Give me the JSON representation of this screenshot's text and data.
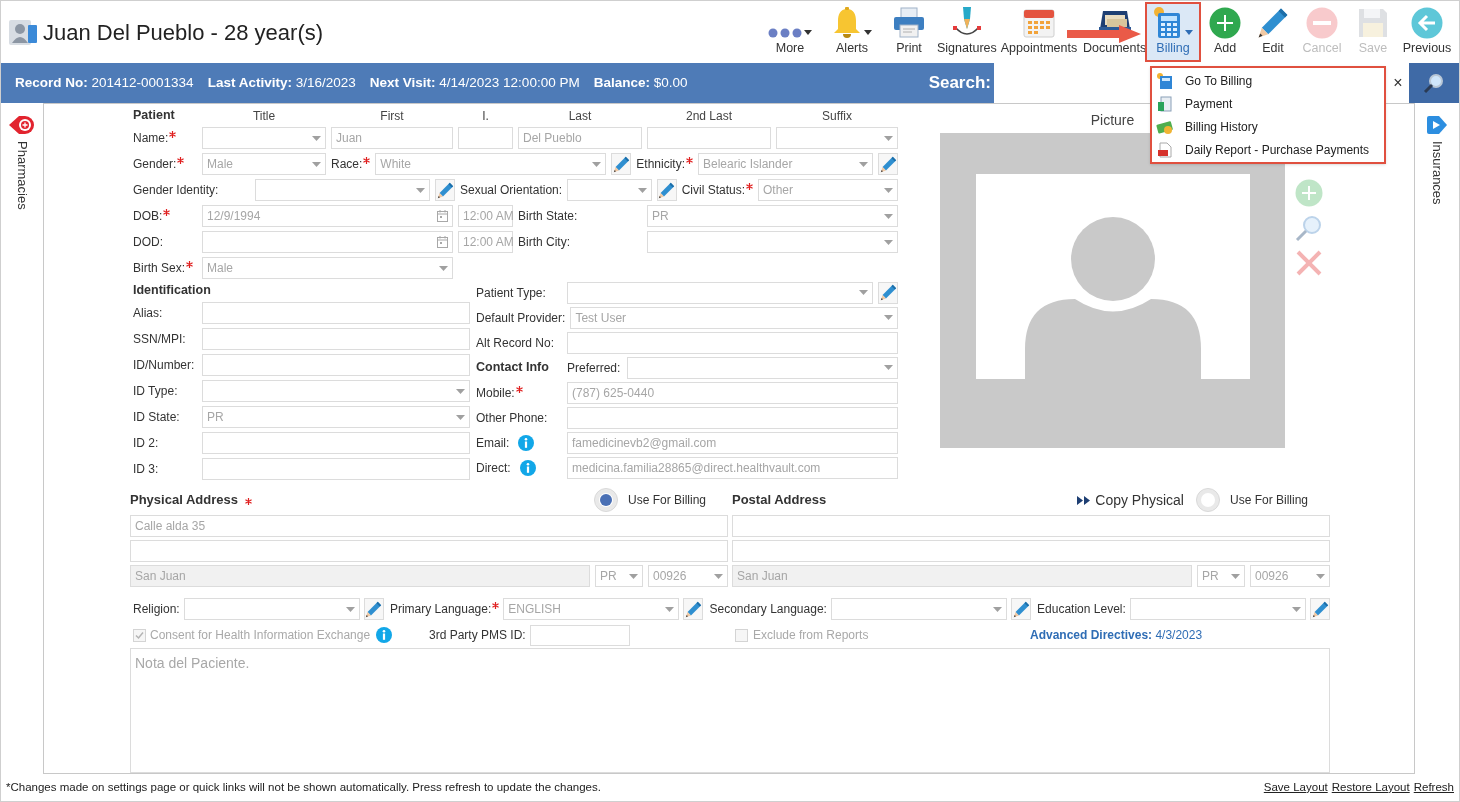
{
  "header": {
    "title": "Juan Del Pueblo - 28 year(s)"
  },
  "toolbar": [
    {
      "label": "More",
      "dropdown": true,
      "disabled": false,
      "selected": false
    },
    {
      "label": "Alerts",
      "dropdown": true,
      "disabled": false,
      "selected": false
    },
    {
      "label": "Print",
      "dropdown": false,
      "disabled": false,
      "selected": false
    },
    {
      "label": "Signatures",
      "dropdown": false,
      "disabled": false,
      "selected": false
    },
    {
      "label": "Appointments",
      "dropdown": false,
      "disabled": false,
      "selected": false
    },
    {
      "label": "Documents",
      "dropdown": false,
      "disabled": false,
      "selected": false
    },
    {
      "label": "Billing",
      "dropdown": true,
      "disabled": false,
      "selected": true
    },
    {
      "label": "Add",
      "dropdown": false,
      "disabled": false,
      "selected": false
    },
    {
      "label": "Edit",
      "dropdown": false,
      "disabled": false,
      "selected": false
    },
    {
      "label": "Cancel",
      "dropdown": false,
      "disabled": true,
      "selected": false
    },
    {
      "label": "Save",
      "dropdown": false,
      "disabled": true,
      "selected": false
    },
    {
      "label": "Previous",
      "dropdown": false,
      "disabled": false,
      "selected": false
    }
  ],
  "billing_menu": [
    "Go To Billing",
    "Payment",
    "Billing History",
    "Daily Report - Purchase Payments"
  ],
  "info_bar": [
    {
      "label": "Record No:",
      "value": "201412-0001334"
    },
    {
      "label": "Last Activity:",
      "value": "3/16/2023"
    },
    {
      "label": "Next Visit:",
      "value": "4/14/2023 12:00:00 PM"
    },
    {
      "label": "Balance:",
      "value": "$0.00"
    }
  ],
  "search": {
    "label": "Search:",
    "clear": "×"
  },
  "side_tabs": {
    "left": "Pharmacies",
    "right": "Insurances"
  },
  "patient_rows": [
    [
      {
        "kind": "heading",
        "text": "Patient"
      },
      {
        "kind": "column",
        "text": "Title"
      },
      {
        "kind": "column",
        "text": "First"
      },
      {
        "kind": "column",
        "text": "I."
      },
      {
        "kind": "column",
        "text": "Last"
      },
      {
        "kind": "column",
        "text": "2nd Last"
      },
      {
        "kind": "column",
        "text": "Suffix"
      }
    ],
    [
      {
        "kind": "label",
        "text": "Name:",
        "required": true
      },
      {
        "kind": "select"
      },
      {
        "kind": "text",
        "value": "Juan"
      },
      {
        "kind": "text"
      },
      {
        "kind": "text",
        "value": "Del Pueblo"
      },
      {
        "kind": "text"
      },
      {
        "kind": "select"
      }
    ],
    [
      {
        "kind": "label",
        "text": "Gender:",
        "required": true
      },
      {
        "kind": "select",
        "value": "Male"
      },
      {
        "kind": "label",
        "text": "Race:",
        "required": true
      },
      {
        "kind": "select",
        "value": "White"
      },
      {
        "kind": "edit"
      },
      {
        "kind": "label",
        "text": "Ethnicity:",
        "required": true
      },
      {
        "kind": "select",
        "value": "Belearic Islander"
      },
      {
        "kind": "edit"
      }
    ],
    [
      {
        "kind": "label",
        "text": "Gender Identity:",
        "required": false
      },
      {
        "kind": "select"
      },
      {
        "kind": "edit"
      },
      {
        "kind": "label",
        "text": "Sexual Orientation:",
        "required": false
      },
      {
        "kind": "select"
      },
      {
        "kind": "edit"
      },
      {
        "kind": "label",
        "text": "Civil Status:",
        "required": true
      },
      {
        "kind": "select",
        "value": "Other"
      }
    ],
    [
      {
        "kind": "label",
        "text": "DOB:",
        "required": true
      },
      {
        "kind": "date",
        "value": "12/9/1994"
      },
      {
        "kind": "time",
        "value": "12:00 AM"
      },
      {
        "kind": "label",
        "text": "Birth State:",
        "required": false
      },
      {
        "kind": "select",
        "value": "PR"
      }
    ],
    [
      {
        "kind": "label",
        "text": "DOD:",
        "required": false
      },
      {
        "kind": "date"
      },
      {
        "kind": "time",
        "value": "12:00 AM"
      },
      {
        "kind": "label",
        "text": "Birth City:",
        "required": false
      },
      {
        "kind": "select"
      }
    ],
    [
      {
        "kind": "label",
        "text": "Birth Sex:",
        "required": true
      },
      {
        "kind": "select",
        "value": "Male"
      }
    ]
  ],
  "identification": {
    "heading": "Identification",
    "rows": [
      [
        {
          "kind": "label",
          "text": "Alias:",
          "required": false
        },
        {
          "kind": "text"
        }
      ],
      [
        {
          "kind": "label",
          "text": "SSN/MPI:",
          "required": false
        },
        {
          "kind": "text"
        }
      ],
      [
        {
          "kind": "label",
          "text": "ID/Number:",
          "required": false
        },
        {
          "kind": "text"
        }
      ],
      [
        {
          "kind": "label",
          "text": "ID Type:",
          "required": false
        },
        {
          "kind": "select"
        }
      ],
      [
        {
          "kind": "label",
          "text": "ID State:",
          "required": false
        },
        {
          "kind": "select",
          "value": "PR"
        }
      ],
      [
        {
          "kind": "label",
          "text": "ID 2:",
          "required": false
        },
        {
          "kind": "text"
        }
      ],
      [
        {
          "kind": "label",
          "text": "ID 3:",
          "required": false
        },
        {
          "kind": "text"
        }
      ]
    ]
  },
  "contact_rows": [
    [
      {
        "kind": "label",
        "text": "Patient Type:",
        "required": false
      },
      {
        "kind": "select"
      },
      {
        "kind": "edit"
      }
    ],
    [
      {
        "kind": "label",
        "text": "Default Provider:",
        "required": false
      },
      {
        "kind": "select",
        "value": "Test User"
      }
    ],
    [
      {
        "kind": "label",
        "text": "Alt Record No:",
        "required": false
      },
      {
        "kind": "text"
      }
    ],
    [
      {
        "kind": "heading",
        "text": "Contact Info"
      },
      {
        "kind": "label",
        "text": "Preferred:",
        "required": false
      },
      {
        "kind": "select"
      }
    ],
    [
      {
        "kind": "label",
        "text": "Mobile:",
        "required": true
      },
      {
        "kind": "text",
        "value": "(787) 625-0440"
      }
    ],
    [
      {
        "kind": "label",
        "text": "Other Phone:",
        "required": false
      },
      {
        "kind": "text"
      }
    ],
    [
      {
        "kind": "label",
        "text": "Email:",
        "required": false
      },
      {
        "kind": "info"
      },
      {
        "kind": "text",
        "value": "famedicinevb2@gmail.com"
      }
    ],
    [
      {
        "kind": "label",
        "text": "Direct:",
        "required": false
      },
      {
        "kind": "info"
      },
      {
        "kind": "text",
        "value": "medicina.familia28865@direct.healthvault.com"
      }
    ]
  ],
  "picture": {
    "label": "Picture"
  },
  "physical_address": {
    "heading": "Physical Address",
    "required": true,
    "use_for_billing": {
      "label": "Use For Billing",
      "checked": true
    },
    "lines": [
      {
        "kind": "text",
        "value": "Calle alda 35",
        "disabled": false
      },
      {
        "kind": "text",
        "disabled": false
      }
    ],
    "city_row": [
      {
        "kind": "text",
        "value": "San Juan",
        "disabled": true
      },
      {
        "kind": "select",
        "value": "PR",
        "disabled": false
      },
      {
        "kind": "select",
        "value": "00926",
        "disabled": false
      }
    ]
  },
  "postal_address": {
    "heading": "Postal Address",
    "required": false,
    "copy_button": "Copy Physical",
    "use_for_billing": {
      "label": "Use For Billing",
      "checked": false
    },
    "lines": [
      {
        "kind": "text",
        "disabled": false
      },
      {
        "kind": "text",
        "disabled": false
      }
    ],
    "city_row": [
      {
        "kind": "text",
        "value": "San Juan",
        "disabled": true
      },
      {
        "kind": "select",
        "value": "PR",
        "disabled": false
      },
      {
        "kind": "select",
        "value": "00926",
        "disabled": false
      }
    ]
  },
  "other_row": [
    {
      "kind": "label",
      "text": "Religion:",
      "required": false
    },
    {
      "kind": "select"
    },
    {
      "kind": "edit"
    },
    {
      "kind": "label",
      "text": "Primary Language:",
      "required": true
    },
    {
      "kind": "select",
      "value": "ENGLISH"
    },
    {
      "kind": "edit"
    },
    {
      "kind": "label",
      "text": "Secondary Language:",
      "required": false
    },
    {
      "kind": "select"
    },
    {
      "kind": "edit"
    },
    {
      "kind": "label",
      "text": "Education Level:",
      "required": false
    },
    {
      "kind": "select"
    },
    {
      "kind": "edit"
    }
  ],
  "consent": {
    "label": "Consent for Health Information Exchange",
    "checked": true,
    "disabled": true
  },
  "pms_id": {
    "label": "3rd Party PMS ID:"
  },
  "exclude": {
    "label": "Exclude from Reports",
    "checked": false,
    "disabled": true
  },
  "advanced_directives": {
    "label": "Advanced Directives:",
    "value": "4/3/2023"
  },
  "notes": {
    "placeholder": "Nota del Paciente."
  },
  "footer": {
    "note": "*Changes made on settings page or quick links will not be shown automatically. Press refresh to update the changes.",
    "links": [
      "Save Layout",
      "Restore Layout",
      "Refresh"
    ]
  }
}
